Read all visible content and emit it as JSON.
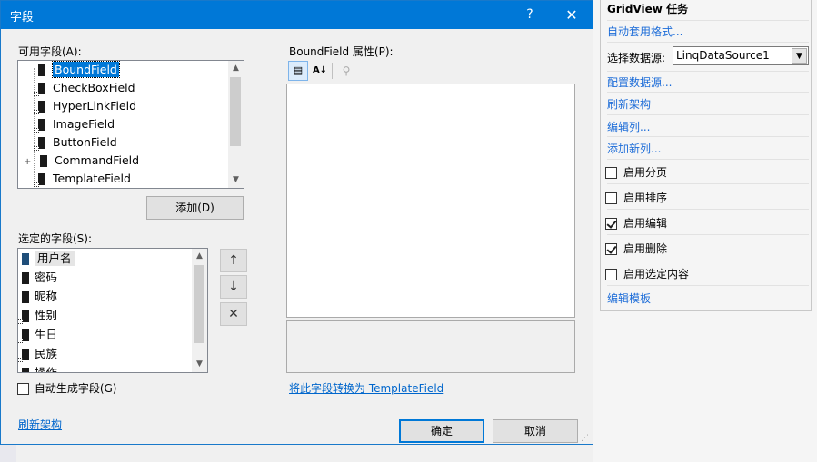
{
  "dialog": {
    "title": "字段",
    "help_glyph": "?",
    "close_glyph": "✕",
    "available_label": "可用字段(A):",
    "available_fields": [
      {
        "label": "BoundField",
        "selected": true
      },
      {
        "label": "CheckBoxField"
      },
      {
        "label": "HyperLinkField"
      },
      {
        "label": "ImageField"
      },
      {
        "label": "ButtonField"
      },
      {
        "label": "CommandField",
        "expander": "+"
      },
      {
        "label": "TemplateField"
      }
    ],
    "add_button": "添加(D)",
    "selected_label": "选定的字段(S):",
    "selected_fields": [
      {
        "label": "用户名",
        "selected": true
      },
      {
        "label": "密码"
      },
      {
        "label": "昵称"
      },
      {
        "label": "性别"
      },
      {
        "label": "生日"
      },
      {
        "label": "民族"
      },
      {
        "label": "操作"
      }
    ],
    "move_up_glyph": "↑",
    "move_down_glyph": "↓",
    "delete_glyph": "✕",
    "autogen_label": "自动生成字段(G)",
    "autogen_checked": false,
    "refresh_schema_link": "刷新架构",
    "properties_label": "BoundField 属性(P):",
    "convert_link": "将此字段转换为 TemplateField",
    "ok_button": "确定",
    "cancel_button": "取消"
  },
  "tasks_panel": {
    "title": "GridView 任务",
    "auto_format_link": "自动套用格式...",
    "datasource_label": "选择数据源:",
    "datasource_value": "LinqDataSource1",
    "configure_datasource_link": "配置数据源...",
    "refresh_schema_link": "刷新架构",
    "edit_columns_link": "编辑列...",
    "add_column_link": "添加新列...",
    "options": [
      {
        "label": "启用分页",
        "checked": false
      },
      {
        "label": "启用排序",
        "checked": false
      },
      {
        "label": "启用编辑",
        "checked": true
      },
      {
        "label": "启用删除",
        "checked": true
      },
      {
        "label": "启用选定内容",
        "checked": false
      }
    ],
    "edit_templates_link": "编辑模板"
  },
  "colors": {
    "titlebar": "#0078d7",
    "selection": "#0078d7",
    "link": "#0066cc"
  }
}
